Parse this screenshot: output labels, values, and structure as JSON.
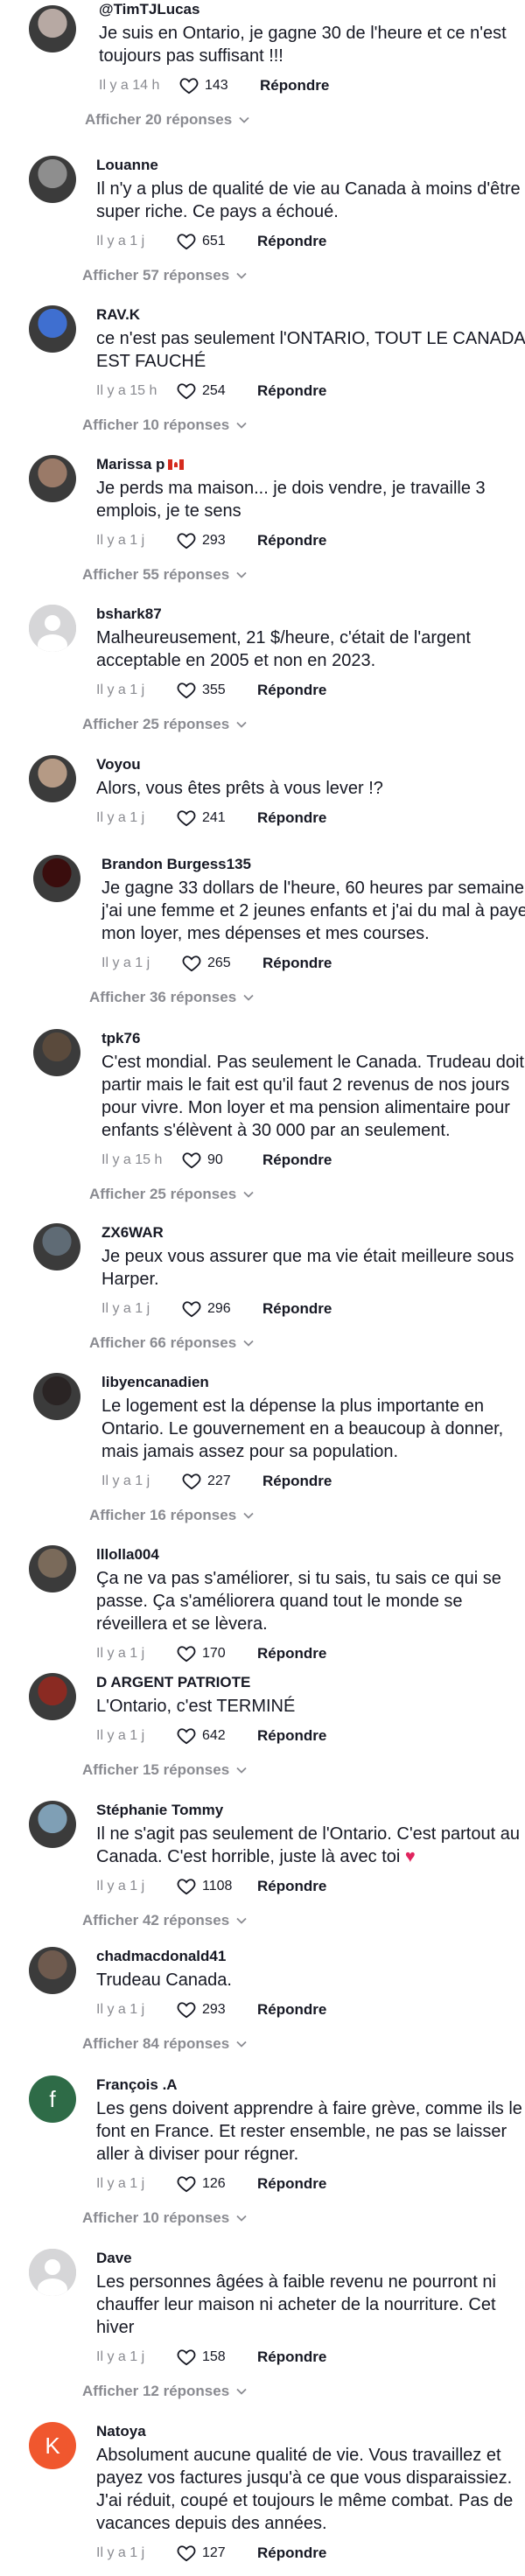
{
  "labels": {
    "reply": "Répondre"
  },
  "comments": [
    {
      "user": "@TimTJLucas",
      "lines": [
        "Je suis en Ontario, je gagne 30 de l'heure et ce n'est",
        "toujours pas suffisant !!!"
      ],
      "time": "Il y a 14 h",
      "likes": "143",
      "replies": "Afficher 20 réponses",
      "avatar_style": "photo",
      "avatar_color": "#b7a9a3"
    },
    {
      "user": "Louanne",
      "lines": [
        "Il n'y a plus de qualité de vie au Canada à moins d'être",
        "super riche. Ce pays a échoué."
      ],
      "time": "Il y a 1 j",
      "likes": "651",
      "replies": "Afficher 57 réponses",
      "avatar_style": "photo",
      "avatar_color": "#8e8e8e"
    },
    {
      "user": "RAV.K",
      "lines": [
        "ce n'est pas seulement l'ONTARIO, TOUT LE CANADA",
        "EST FAUCHÉ"
      ],
      "time": "Il y a 15 h",
      "likes": "254",
      "replies": "Afficher 10 réponses",
      "avatar_style": "photo",
      "avatar_color": "#3f6fd0"
    },
    {
      "user": "Marissa p",
      "flag": true,
      "lines": [
        "Je perds ma maison... je dois vendre, je travaille 3",
        "emplois, je te sens"
      ],
      "time": "Il y a 1 j",
      "likes": "293",
      "replies": "Afficher 55 réponses",
      "avatar_style": "photo",
      "avatar_color": "#9a7a68"
    },
    {
      "user": "bshark87",
      "lines": [
        "Malheureusement, 21 $/heure, c'était de l'argent",
        "acceptable en 2005 et non en 2023."
      ],
      "time": "Il y a 1 j",
      "likes": "355",
      "replies": "Afficher 25 réponses",
      "avatar_style": "default",
      "avatar_color": "#d6d6d8"
    },
    {
      "user": "Voyou",
      "lines": [
        "Alors, vous êtes prêts à vous lever !?"
      ],
      "time": "Il y a 1 j",
      "likes": "241",
      "replies": "",
      "avatar_style": "photo",
      "avatar_color": "#b59a85"
    },
    {
      "user": "Brandon Burgess135",
      "lines": [
        "Je gagne 33 dollars de l'heure, 60 heures par semaine,",
        "j'ai une femme et 2 jeunes enfants et j'ai du mal à paye",
        "mon loyer, mes dépenses et mes courses."
      ],
      "time": "Il y a 1 j",
      "likes": "265",
      "replies": "Afficher 36 réponses",
      "avatar_style": "photo",
      "avatar_color": "#3a0d0d"
    },
    {
      "user": "tpk76",
      "lines": [
        "C'est mondial. Pas seulement le Canada. Trudeau doit",
        "partir mais le fait est qu'il faut 2 revenus de nos jours",
        "pour vivre. Mon loyer et ma pension alimentaire pour",
        "enfants s'élèvent à 30 000 par an seulement."
      ],
      "time": "Il y a 15 h",
      "likes": "90",
      "replies": "Afficher 25 réponses",
      "avatar_style": "photo",
      "avatar_color": "#5a4a3c"
    },
    {
      "user": "ZX6WAR",
      "lines": [
        "Je peux vous assurer que ma vie était meilleure sous",
        "Harper."
      ],
      "time": "Il y a 1 j",
      "likes": "296",
      "replies": "Afficher 66 réponses",
      "avatar_style": "photo",
      "avatar_color": "#5f6b75"
    },
    {
      "user": "libyencanadien",
      "lines": [
        "Le logement est la dépense la plus importante en",
        "Ontario. Le gouvernement en a beaucoup à donner,",
        "mais jamais assez pour sa population."
      ],
      "time": "Il y a 1 j",
      "likes": "227",
      "replies": "Afficher 16 réponses",
      "avatar_style": "photo",
      "avatar_color": "#2a2424"
    },
    {
      "user": "lllolla004",
      "lines": [
        "Ça ne va pas s'améliorer, si tu sais, tu sais ce qui se",
        "passe. Ça s'améliorera quand tout le monde se",
        "réveillera et se lèvera."
      ],
      "time": "Il y a 1 j",
      "likes": "170",
      "replies": "",
      "avatar_style": "photo",
      "avatar_color": "#7a6a5a"
    },
    {
      "user": "D ARGENT PATRIOTE",
      "lines": [
        "L'Ontario, c'est TERMINÉ"
      ],
      "time": "Il y a 1 j",
      "likes": "642",
      "replies": "Afficher 15 réponses",
      "avatar_style": "photo",
      "avatar_color": "#8a2a22"
    },
    {
      "user": "Stéphanie Tommy",
      "lines": [
        "Il ne s'agit pas seulement de l'Ontario. C'est partout au",
        "Canada. C'est horrible, juste là avec toi"
      ],
      "heart_emoji": "♥",
      "time": "Il y a 1 j",
      "likes": "1108",
      "replies": "Afficher 42 réponses",
      "avatar_style": "photo",
      "avatar_color": "#7f9fb5"
    },
    {
      "user": "chadmacdonald41",
      "lines": [
        "Trudeau Canada."
      ],
      "time": "Il y a 1 j",
      "likes": "293",
      "replies": "Afficher 84 réponses",
      "avatar_style": "photo",
      "avatar_color": "#6e5a4e"
    },
    {
      "user": "François .A",
      "lines": [
        "Les gens doivent apprendre à faire grève, comme ils le",
        "font en France. Et rester ensemble, ne pas se laisser",
        "aller à diviser pour régner."
      ],
      "time": "Il y a 1 j",
      "likes": "126",
      "replies": "Afficher 10 réponses",
      "avatar_style": "letter",
      "avatar_letter": "f",
      "avatar_color": "#2e6b47"
    },
    {
      "user": "Dave",
      "lines": [
        "Les personnes âgées à faible revenu ne pourront ni",
        "chauffer leur maison ni acheter de la nourriture. Cet",
        "hiver"
      ],
      "time": "Il y a 1 j",
      "likes": "158",
      "replies": "Afficher 12 réponses",
      "avatar_style": "default",
      "avatar_color": "#d6d6d8"
    },
    {
      "user": "Natoya",
      "lines": [
        "Absolument aucune qualité de vie. Vous travaillez et",
        "payez vos factures jusqu'à ce que vous disparaissiez.",
        "J'ai réduit, coupé et toujours le même combat. Pas de",
        "vacances depuis des années."
      ],
      "time": "Il y a 1 j",
      "likes": "127",
      "replies": "",
      "avatar_style": "letter",
      "avatar_letter": "K",
      "avatar_color": "#f0572e"
    }
  ]
}
